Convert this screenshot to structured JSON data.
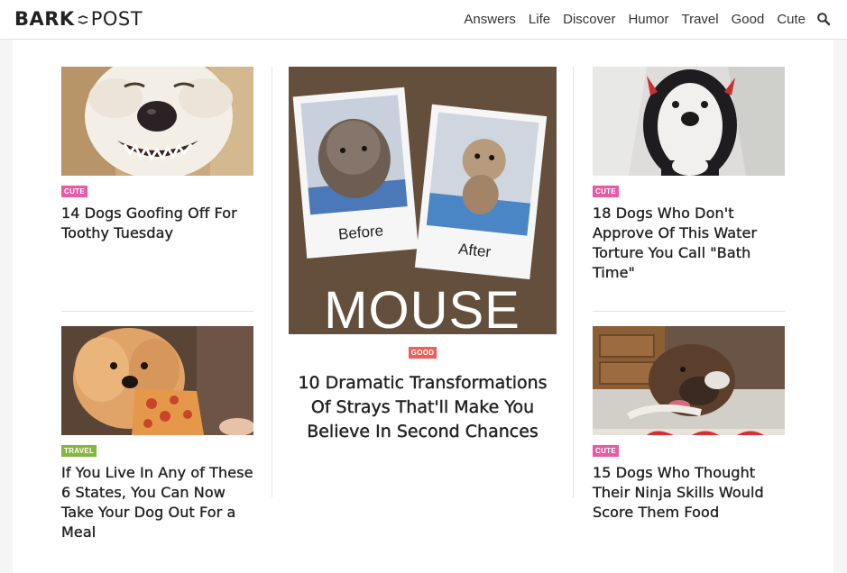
{
  "brand": {
    "logo_left": "BARK",
    "logo_right": "POST"
  },
  "nav": {
    "items": [
      "Answers",
      "Life",
      "Discover",
      "Humor",
      "Travel",
      "Good",
      "Cute"
    ]
  },
  "articles": {
    "left_top": {
      "badge": "CUTE",
      "title": "14 Dogs Goofing Off For Toothy Tuesday"
    },
    "left_bottom": {
      "badge": "TRAVEL",
      "title": "If You Live In Any of These 6 States, You Can Now Take Your Dog Out For a Meal"
    },
    "feature": {
      "badge": "GOOD",
      "title": "10 Dramatic Transformations Of Strays That'll Make You Believe In Second Chances",
      "image_text": {
        "before": "Before",
        "after": "After",
        "name": "MOUSE"
      }
    },
    "right_top": {
      "badge": "CUTE",
      "title": "18 Dogs Who Don't Approve Of This Water Torture You Call \"Bath Time\""
    },
    "right_bottom": {
      "badge": "CUTE",
      "title": "15 Dogs Who Thought Their Ninja Skills Would Score Them Food"
    }
  },
  "colors": {
    "cute": "#e85aa6",
    "good": "#ee5f5b",
    "travel": "#84b73d"
  }
}
